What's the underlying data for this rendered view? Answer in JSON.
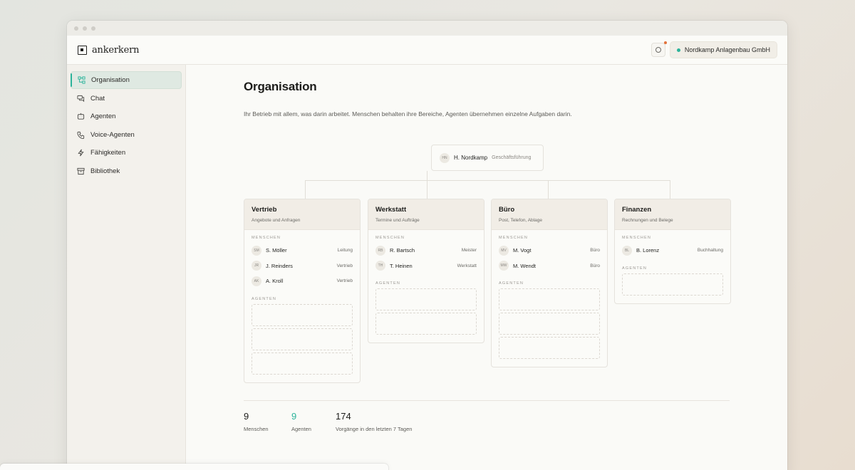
{
  "app": {
    "logo_text": "ankerkern",
    "org_name": "Nordkamp Anlagenbau GmbH",
    "colors": {
      "accent": "#2bb39a",
      "notification": "#e2723b"
    }
  },
  "sidebar": {
    "items": [
      {
        "label": "Organisation",
        "icon": "org-chart-icon",
        "active": true
      },
      {
        "label": "Chat",
        "icon": "chat-icon"
      },
      {
        "label": "Agenten",
        "icon": "robot-icon"
      },
      {
        "label": "Voice-Agenten",
        "icon": "phone-icon"
      },
      {
        "label": "Fähigkeiten",
        "icon": "lightning-icon"
      },
      {
        "label": "Bibliothek",
        "icon": "archive-icon"
      }
    ]
  },
  "page": {
    "title": "Organisation",
    "description": "Ihr Betrieb mit allem, was darin arbeitet. Menschen behalten ihre Bereiche, Agenten übernehmen einzelne Aufgaben darin."
  },
  "head": {
    "initials": "HN",
    "name": "H. Nordkamp",
    "role": "Geschäftsführung"
  },
  "labels": {
    "people": "MENSCHEN",
    "agents": "AGENTEN"
  },
  "departments": [
    {
      "name": "Vertrieb",
      "subtitle": "Angebote und Anfragen",
      "people": [
        {
          "initials": "SM",
          "name": "S. Möller",
          "role": "Leitung"
        },
        {
          "initials": "JR",
          "name": "J. Reinders",
          "role": "Vertrieb"
        },
        {
          "initials": "AK",
          "name": "A. Kroll",
          "role": "Vertrieb"
        }
      ]
    },
    {
      "name": "Werkstatt",
      "subtitle": "Termine und Aufträge",
      "people": [
        {
          "initials": "RB",
          "name": "R. Bartsch",
          "role": "Meister"
        },
        {
          "initials": "TH",
          "name": "T. Heinen",
          "role": "Werkstatt"
        }
      ]
    },
    {
      "name": "Büro",
      "subtitle": "Post, Telefon, Ablage",
      "people": [
        {
          "initials": "MV",
          "name": "M. Vogt",
          "role": "Büro"
        },
        {
          "initials": "MW",
          "name": "M. Wendt",
          "role": "Büro"
        }
      ]
    },
    {
      "name": "Finanzen",
      "subtitle": "Rechnungen und Belege",
      "people": [
        {
          "initials": "BL",
          "name": "B. Lorenz",
          "role": "Buchhaltung"
        }
      ]
    }
  ],
  "stats": [
    {
      "value": "9",
      "label": "Menschen",
      "accent": false
    },
    {
      "value": "9",
      "label": "Agenten",
      "accent": true
    },
    {
      "value": "174",
      "label": "Vorgänge in den letzten 7 Tagen",
      "accent": false
    }
  ]
}
